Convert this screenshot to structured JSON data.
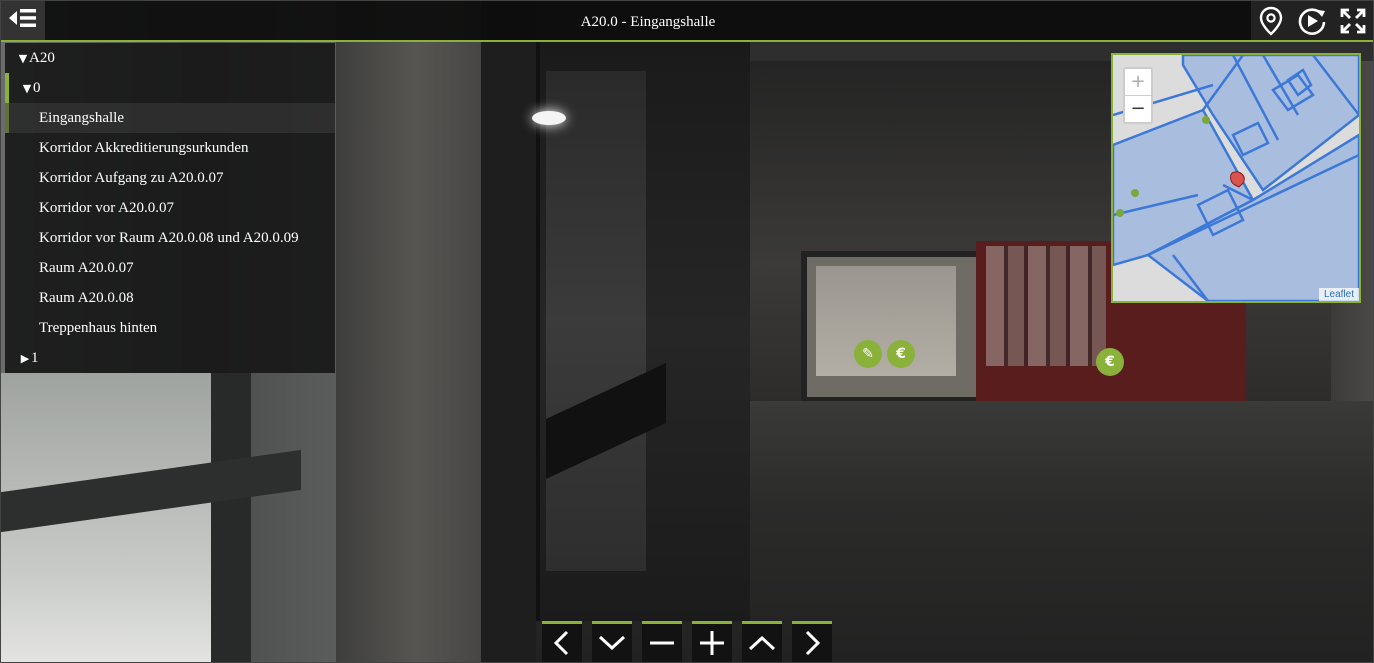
{
  "header": {
    "title": "A20.0 - Eingangshalle",
    "back_icon": "menu-collapse-icon",
    "icons": [
      "map-pin-icon",
      "autoplay-icon",
      "fullscreen-icon"
    ]
  },
  "tree": {
    "building": "A20",
    "floor": "0",
    "rooms": [
      {
        "label": "Eingangshalle",
        "active": true
      },
      {
        "label": "Korridor Akkreditierungsurkunden"
      },
      {
        "label": "Korridor Aufgang zu A20.0.07"
      },
      {
        "label": "Korridor vor A20.0.07"
      },
      {
        "label": "Korridor vor Raum A20.0.08 und A20.0.09"
      },
      {
        "label": "Raum A20.0.07"
      },
      {
        "label": "Raum A20.0.08"
      },
      {
        "label": "Treppenhaus hinten"
      }
    ],
    "collapsed_floor": "1"
  },
  "minimap": {
    "zoom_in": "+",
    "zoom_out": "−",
    "attribution": "Leaflet"
  },
  "hotspots": [
    {
      "icon": "wrench-icon",
      "glyph": "✎"
    },
    {
      "icon": "euro-icon",
      "glyph": "€"
    },
    {
      "icon": "euro-icon",
      "glyph": "€"
    }
  ],
  "colors": {
    "accent": "#8ab13a",
    "bar": "#0c0c0c",
    "map_building": "#a9bedf",
    "map_line": "#3c78d8",
    "map_marker": "#d9534f"
  },
  "controls": [
    "pan-left-icon",
    "tilt-down-icon",
    "zoom-out-icon",
    "zoom-in-icon",
    "tilt-up-icon",
    "pan-right-icon"
  ]
}
